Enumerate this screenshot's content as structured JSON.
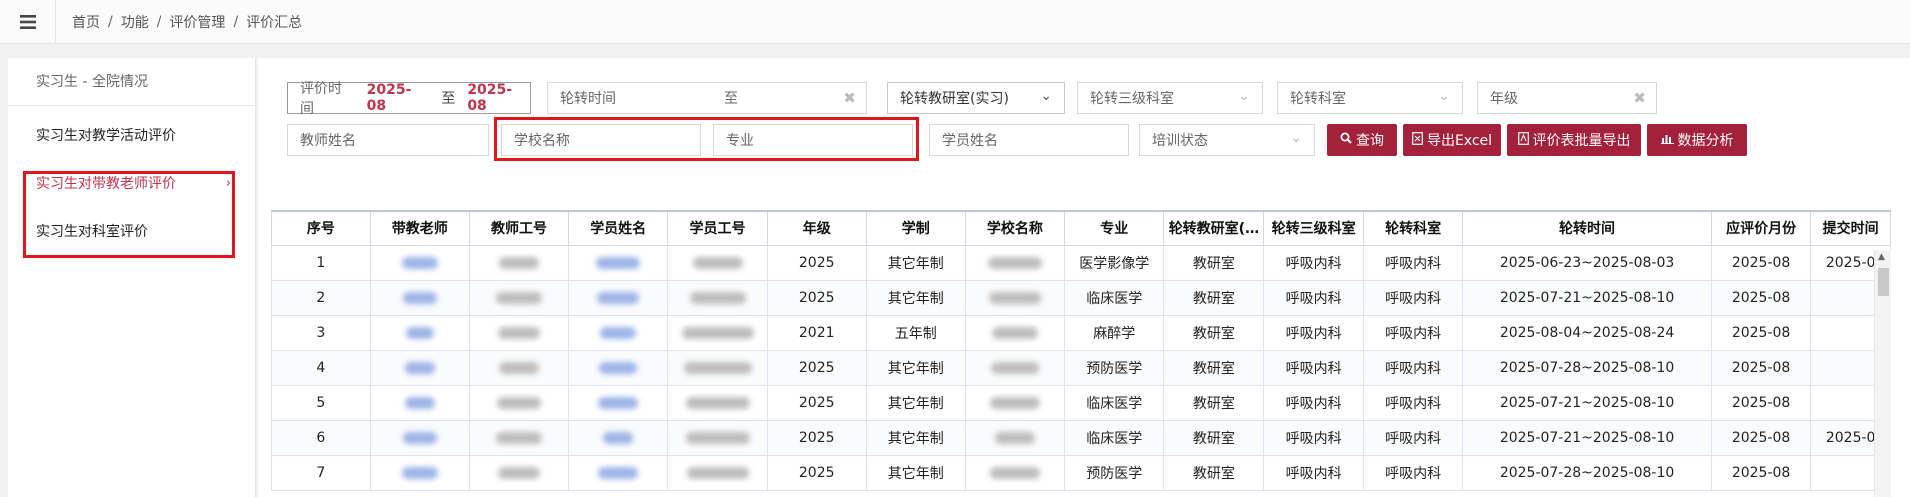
{
  "breadcrumb": [
    "首页",
    "功能",
    "评价管理",
    "评价汇总"
  ],
  "sidebar": {
    "header": "实习生 - 全院情况",
    "items": [
      {
        "label": "实习生对教学活动评价"
      },
      {
        "label": "实习生对带教老师评价",
        "active": true,
        "arrow": "›"
      },
      {
        "label": "实习生对科室评价"
      }
    ]
  },
  "filters": {
    "date_label": "评价时间",
    "date_from": "2025-08",
    "date_to_sep": "至",
    "date_to": "2025-08",
    "rotation_time_placeholder": "轮转时间",
    "rotation_time_sep": "至",
    "teaching_dept_value": "轮转教研室(实习)",
    "level3_dept_placeholder": "轮转三级科室",
    "rotation_dept_placeholder": "轮转科室",
    "grade_placeholder": "年级",
    "teacher_name_placeholder": "教师姓名",
    "school_placeholder": "学校名称",
    "major_placeholder": "专业",
    "student_name_placeholder": "学员姓名",
    "training_status_placeholder": "培训状态"
  },
  "buttons": {
    "query": "查询",
    "export_excel": "导出Excel",
    "batch_export": "评价表批量导出",
    "analysis": "数据分析"
  },
  "table": {
    "headers": [
      "序号",
      "带教老师",
      "教师工号",
      "学员姓名",
      "学员工号",
      "年级",
      "学制",
      "学校名称",
      "专业",
      "轮转教研室(…",
      "轮转三级科室",
      "轮转科室",
      "轮转时间",
      "应评价月份",
      "提交时间"
    ],
    "rows": [
      {
        "no": "1",
        "grade": "2025",
        "system": "其它年制",
        "major": "医学影像学",
        "dept": "教研室",
        "level3": "呼吸内科",
        "rot_dept": "呼吸内科",
        "time": "2025-06-23~2025-08-03",
        "month": "2025-08",
        "submit": "2025-0"
      },
      {
        "no": "2",
        "grade": "2025",
        "system": "其它年制",
        "major": "临床医学",
        "dept": "教研室",
        "level3": "呼吸内科",
        "rot_dept": "呼吸内科",
        "time": "2025-07-21~2025-08-10",
        "month": "2025-08",
        "submit": ""
      },
      {
        "no": "3",
        "grade": "2021",
        "system": "五年制",
        "major": "麻醉学",
        "dept": "教研室",
        "level3": "呼吸内科",
        "rot_dept": "呼吸内科",
        "time": "2025-08-04~2025-08-24",
        "month": "2025-08",
        "submit": ""
      },
      {
        "no": "4",
        "grade": "2025",
        "system": "其它年制",
        "major": "预防医学",
        "dept": "教研室",
        "level3": "呼吸内科",
        "rot_dept": "呼吸内科",
        "time": "2025-07-28~2025-08-10",
        "month": "2025-08",
        "submit": ""
      },
      {
        "no": "5",
        "grade": "2025",
        "system": "其它年制",
        "major": "临床医学",
        "dept": "教研室",
        "level3": "呼吸内科",
        "rot_dept": "呼吸内科",
        "time": "2025-07-21~2025-08-10",
        "month": "2025-08",
        "submit": ""
      },
      {
        "no": "6",
        "grade": "2025",
        "system": "其它年制",
        "major": "临床医学",
        "dept": "教研室",
        "level3": "呼吸内科",
        "rot_dept": "呼吸内科",
        "time": "2025-07-21~2025-08-10",
        "month": "2025-08",
        "submit": "2025-0"
      },
      {
        "no": "7",
        "grade": "2025",
        "system": "其它年制",
        "major": "预防医学",
        "dept": "教研室",
        "level3": "呼吸内科",
        "rot_dept": "呼吸内科",
        "time": "2025-07-28~2025-08-10",
        "month": "2025-08",
        "submit": ""
      }
    ]
  },
  "colors": {
    "accent": "#a3213a",
    "active_text": "#c0334d",
    "highlight_box": "#e0161c"
  },
  "icons": {
    "menu": "hamburger-icon",
    "search": "search-icon",
    "excel": "file-excel-icon",
    "pdf": "file-pdf-icon",
    "chart": "bar-chart-icon"
  }
}
